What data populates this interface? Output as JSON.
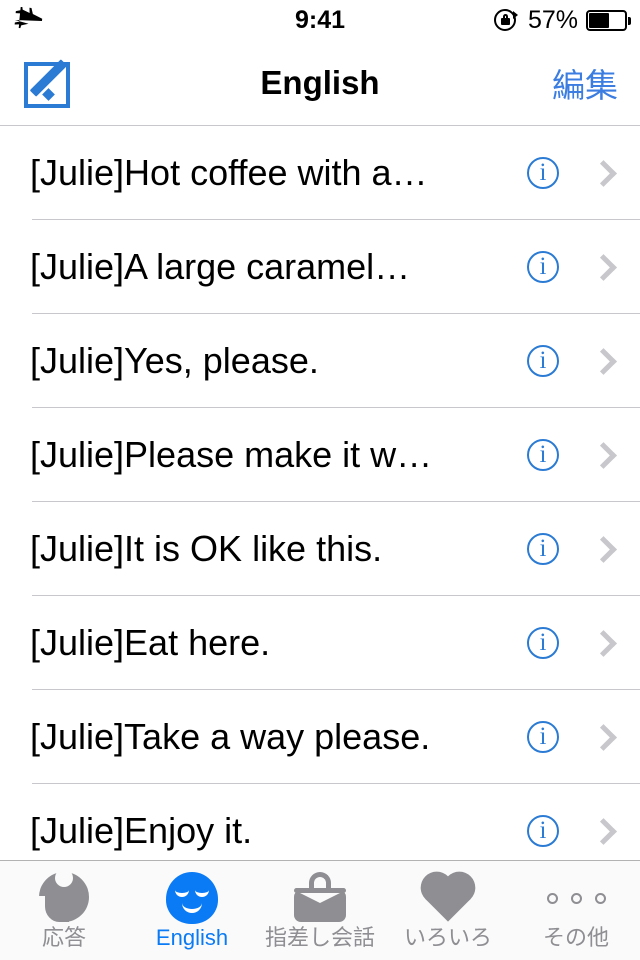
{
  "status_bar": {
    "airplane_icon": "airplane-icon",
    "time": "9:41",
    "rotation_lock_icon": "rotation-lock-icon",
    "battery_percent": "57%",
    "battery_icon": "battery-icon"
  },
  "nav_bar": {
    "compose_icon": "compose-icon",
    "title": "English",
    "edit_label": "編集"
  },
  "list": {
    "rows": [
      {
        "text": "[Julie]Hot coffee with a…",
        "info": "i"
      },
      {
        "text": "[Julie]A large caramel…",
        "info": "i"
      },
      {
        "text": "[Julie]Yes, please.",
        "info": "i"
      },
      {
        "text": "[Julie]Please make it w…",
        "info": "i"
      },
      {
        "text": "[Julie]It is OK like this.",
        "info": "i"
      },
      {
        "text": "[Julie]Eat here.",
        "info": "i"
      },
      {
        "text": "[Julie]Take a way please.",
        "info": "i"
      },
      {
        "text": "[Julie]Enjoy it.",
        "info": "i"
      }
    ]
  },
  "tab_bar": {
    "tabs": [
      {
        "label": "応答",
        "icon": "speech-reply-icon",
        "active": false
      },
      {
        "label": "English",
        "icon": "smiley-face-icon",
        "active": true
      },
      {
        "label": "指差し会話",
        "icon": "handbag-icon",
        "active": false
      },
      {
        "label": "いろいろ",
        "icon": "heart-icon",
        "active": false
      },
      {
        "label": "その他",
        "icon": "more-dots-icon",
        "active": false
      }
    ]
  },
  "colors": {
    "accent_blue": "#0b7bf5",
    "nav_blue": "#3b7de0",
    "inactive_gray": "#8e8e93",
    "separator": "#c8c7cc",
    "chevron": "#c7c7cc"
  }
}
